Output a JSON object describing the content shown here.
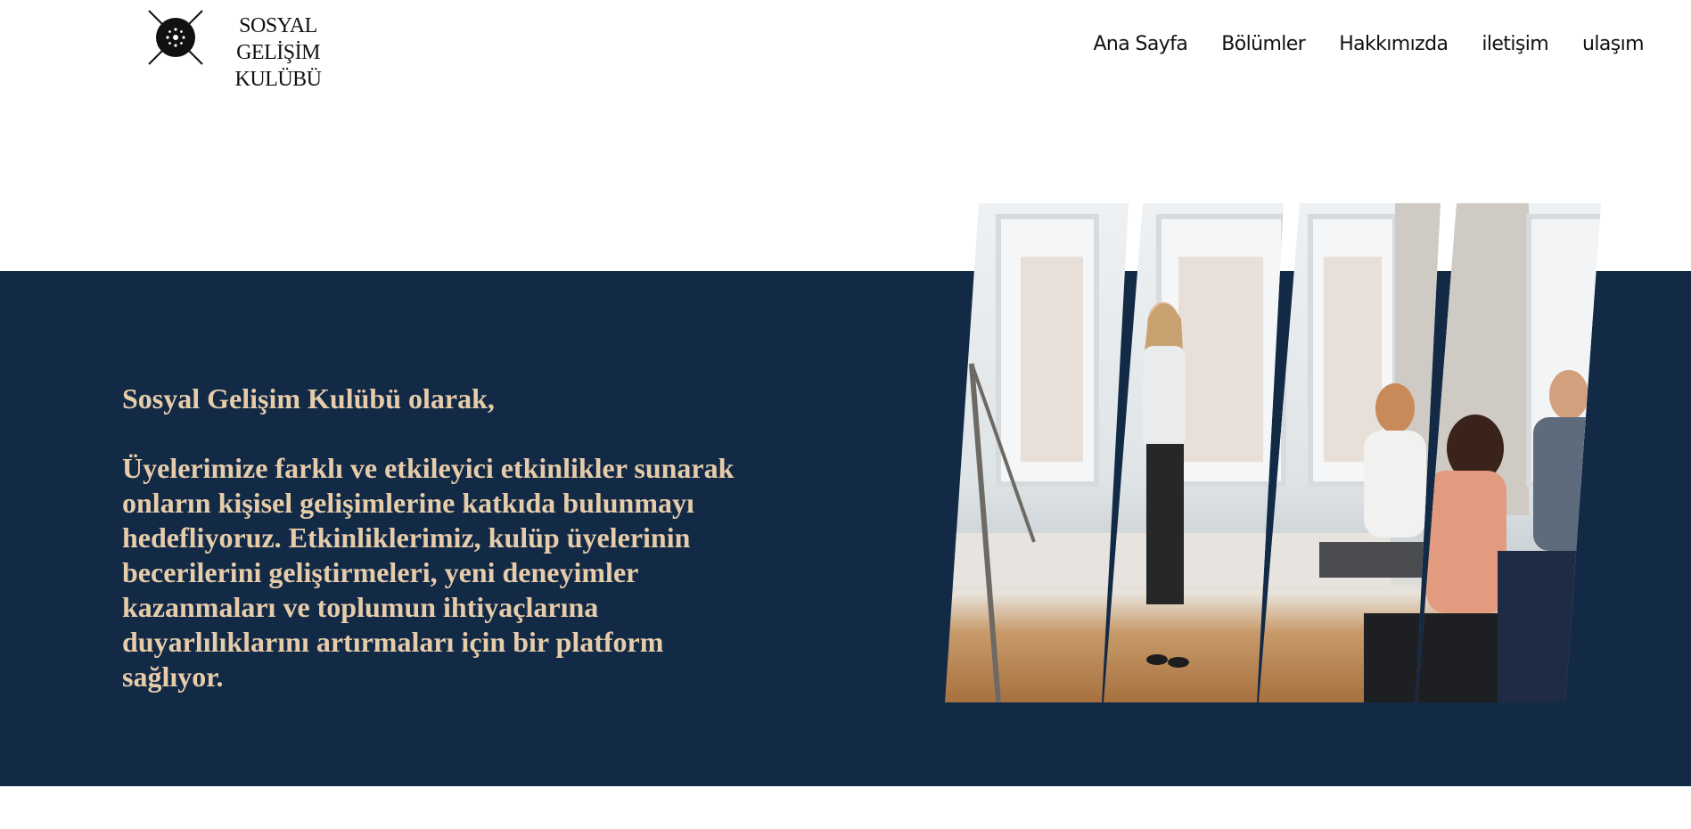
{
  "brand": {
    "line1": "SOSYAL GELİŞİM",
    "line2": "KULÜBÜ"
  },
  "nav": {
    "items": [
      {
        "label": "Ana Sayfa"
      },
      {
        "label": "Bölümler"
      },
      {
        "label": "Hakkımızda"
      },
      {
        "label": "iletişim"
      },
      {
        "label": "ulaşım"
      }
    ]
  },
  "hero": {
    "heading": "Sosyal Gelişim Kulübü olarak,",
    "body_lines": [
      "Üyelerimize farklı ve etkileyici etkinlikler sunarak",
      "onların kişisel gelişimlerine katkıda bulunmayı",
      "hedefliyoruz. Etkinliklerimiz, kulüp üyelerinin",
      "becerilerini geliştirmeleri, yeni deneyimler",
      "kazanmaları ve toplumun ihtiyaçlarına",
      "duyarlılıklarını artırmaları için bir platform",
      "sağlıyor."
    ]
  },
  "colors": {
    "band": "#132a47",
    "accent_text": "#e7ccaa",
    "nav_text": "#111111"
  }
}
